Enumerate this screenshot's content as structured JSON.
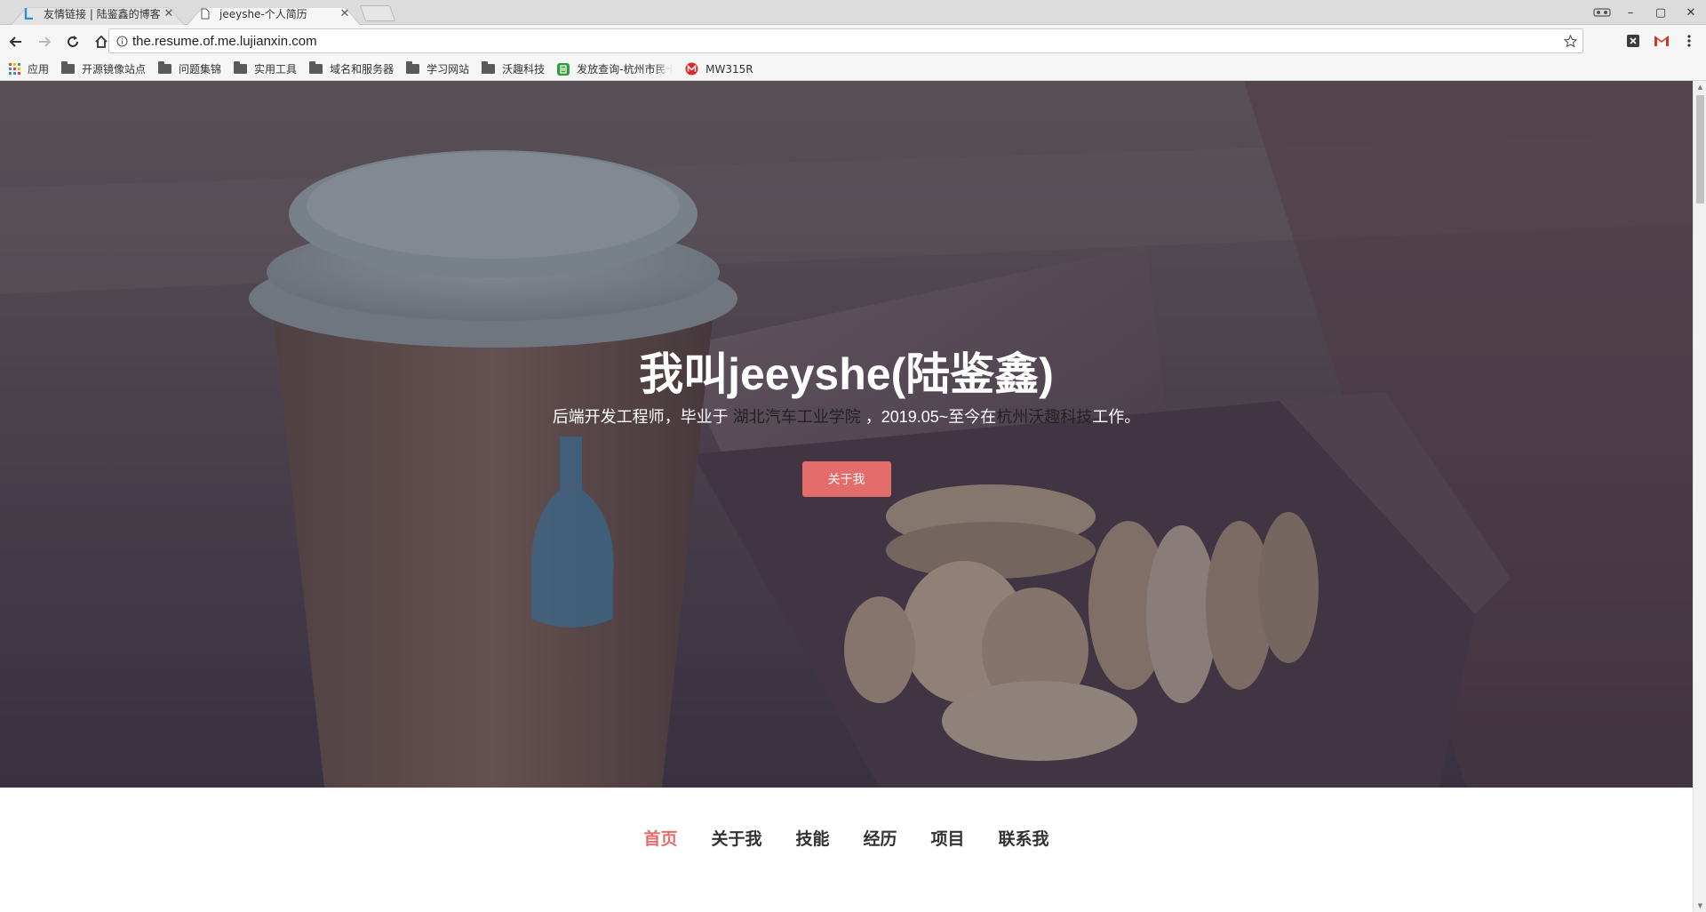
{
  "tabs": [
    {
      "title": "友情链接 | 陆鉴鑫的博客",
      "active": false,
      "favicon": "blog-l-icon"
    },
    {
      "title": "jeeyshe-个人简历",
      "active": true,
      "favicon": "page-icon"
    }
  ],
  "address_bar": {
    "url": "the.resume.of.me.lujianxin.com"
  },
  "bookmarks": [
    {
      "label": "应用",
      "icon": "apps-grid-icon"
    },
    {
      "label": "开源镜像站点",
      "icon": "folder-icon"
    },
    {
      "label": "问题集锦",
      "icon": "folder-icon"
    },
    {
      "label": "实用工具",
      "icon": "folder-icon"
    },
    {
      "label": "域名和服务器",
      "icon": "folder-icon"
    },
    {
      "label": "学习网站",
      "icon": "folder-icon"
    },
    {
      "label": "沃趣科技",
      "icon": "folder-icon"
    },
    {
      "label": "发放查询-杭州市民卡",
      "icon": "green-app-icon"
    },
    {
      "label": "MW315R",
      "icon": "mercury-router-icon"
    }
  ],
  "hero": {
    "title": "我叫jeeyshe(陆鉴鑫)",
    "subtitle": {
      "prefix": "后端开发工程师，毕业于",
      "school": "湖北汽车工业学院",
      "middle": "，2019.05~至今在",
      "company": "杭州沃趣科技",
      "suffix": "工作。"
    },
    "button_label": "关于我"
  },
  "page_nav": [
    {
      "label": "首页",
      "active": true
    },
    {
      "label": "关于我",
      "active": false
    },
    {
      "label": "技能",
      "active": false
    },
    {
      "label": "经历",
      "active": false
    },
    {
      "label": "项目",
      "active": false
    },
    {
      "label": "联系我",
      "active": false
    }
  ],
  "colors": {
    "accent": "#e46d6b",
    "nav_text": "#333333"
  }
}
